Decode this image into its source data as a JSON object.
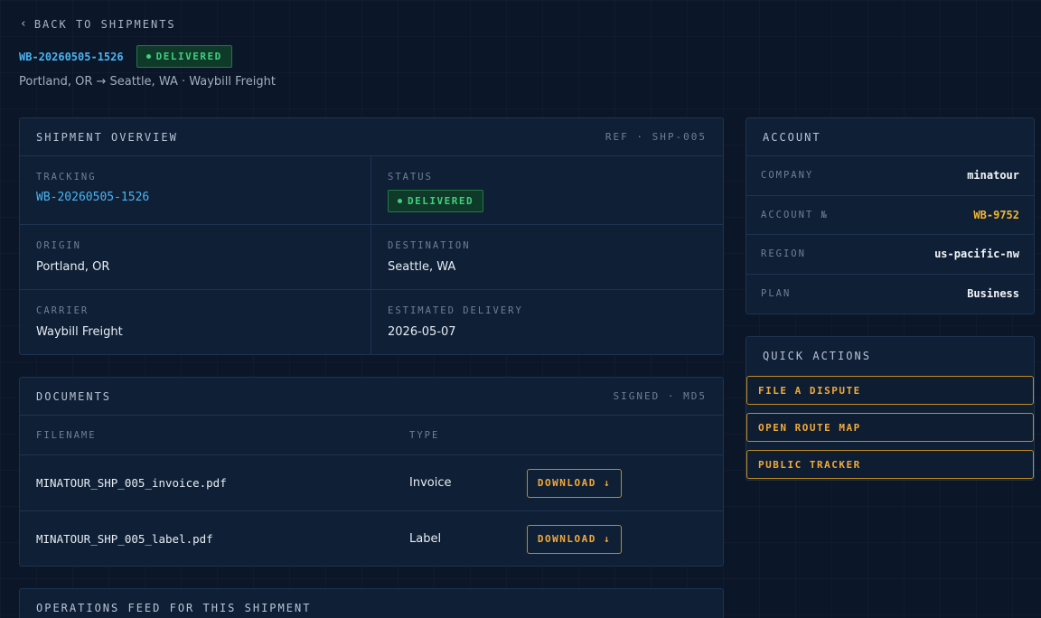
{
  "nav": {
    "back_label": "BACK TO SHIPMENTS"
  },
  "header": {
    "waybill": "WB-20260505-1526",
    "status": "DELIVERED",
    "subtitle": "Portland, OR → Seattle, WA · Waybill Freight"
  },
  "overview": {
    "title": "SHIPMENT OVERVIEW",
    "ref": "REF · SHP-005",
    "tracking_label": "TRACKING",
    "tracking_value": "WB-20260505-1526",
    "status_label": "STATUS",
    "status_value": "DELIVERED",
    "origin_label": "ORIGIN",
    "origin_value": "Portland, OR",
    "destination_label": "DESTINATION",
    "destination_value": "Seattle, WA",
    "carrier_label": "CARRIER",
    "carrier_value": "Waybill Freight",
    "eta_label": "ESTIMATED DELIVERY",
    "eta_value": "2026-05-07"
  },
  "documents": {
    "title": "DOCUMENTS",
    "meta": "SIGNED · MD5",
    "col_filename": "FILENAME",
    "col_type": "TYPE",
    "rows": [
      {
        "filename": "MINATOUR_SHP_005_invoice.pdf",
        "type": "Invoice",
        "action": "DOWNLOAD ↓"
      },
      {
        "filename": "MINATOUR_SHP_005_label.pdf",
        "type": "Label",
        "action": "DOWNLOAD ↓"
      }
    ]
  },
  "feed": {
    "title": "OPERATIONS FEED FOR THIS SHIPMENT"
  },
  "account": {
    "title": "ACCOUNT",
    "company_label": "COMPANY",
    "company_value": "minatour",
    "number_label": "ACCOUNT №",
    "number_value": "WB-9752",
    "region_label": "REGION",
    "region_value": "us-pacific-nw",
    "plan_label": "PLAN",
    "plan_value": "Business"
  },
  "quick_actions": {
    "title": "QUICK ACTIONS",
    "dispute": "FILE A DISPUTE",
    "route_map": "OPEN ROUTE MAP",
    "tracker": "PUBLIC TRACKER"
  },
  "colors": {
    "background": "#0b1628",
    "card": "#0f2036",
    "link": "#4cb3f0",
    "success": "#3fd07b",
    "accent": "#f2a93b"
  }
}
